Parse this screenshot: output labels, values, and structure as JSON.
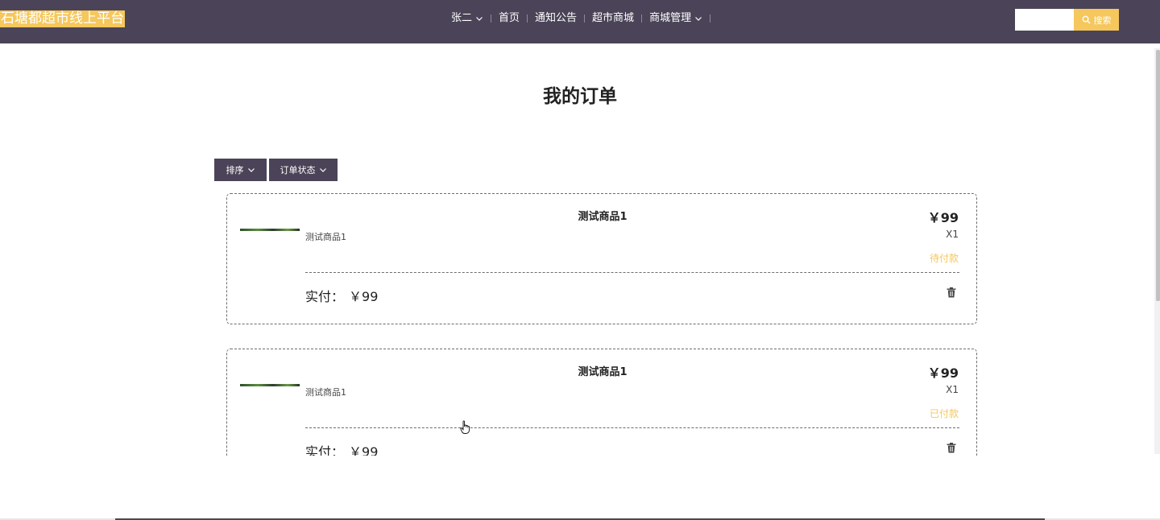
{
  "header": {
    "brand": "石塘都超市线上平台",
    "nav": {
      "user": "张二",
      "items": [
        "首页",
        "通知公告",
        "超市商城"
      ],
      "manage": "商城管理"
    },
    "search": {
      "value": "",
      "placeholder": "",
      "button_label": "搜索"
    }
  },
  "main": {
    "title": "我的订单",
    "filters": {
      "sort_label": "排序",
      "status_label": "订单状态"
    },
    "orders": [
      {
        "name": "测试商品1",
        "description": "测试商品1",
        "price": "￥99",
        "quantity": "X1",
        "status": "待付款",
        "paid_label": "实付：",
        "paid_amount": "￥99"
      },
      {
        "name": "测试商品1",
        "description": "测试商品1",
        "price": "￥99",
        "quantity": "X1",
        "status": "已付款",
        "paid_label": "实付：",
        "paid_amount": "￥99"
      }
    ]
  },
  "colors": {
    "navbar": "#4b4458",
    "accent": "#f5c75c"
  }
}
